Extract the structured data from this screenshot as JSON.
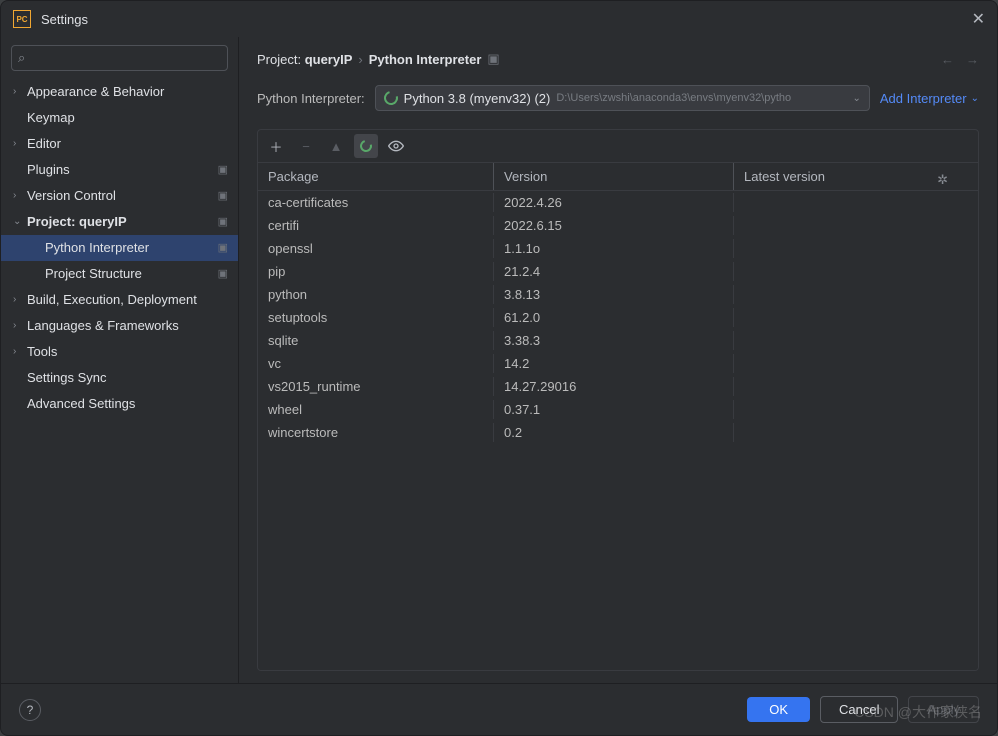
{
  "window": {
    "title": "Settings"
  },
  "search": {
    "placeholder": ""
  },
  "tree": {
    "appearance": "Appearance & Behavior",
    "keymap": "Keymap",
    "editor": "Editor",
    "plugins": "Plugins",
    "vcs": "Version Control",
    "project": "Project: queryIP",
    "python_interpreter": "Python Interpreter",
    "project_structure": "Project Structure",
    "build": "Build, Execution, Deployment",
    "languages": "Languages & Frameworks",
    "tools": "Tools",
    "settings_sync": "Settings Sync",
    "advanced": "Advanced Settings"
  },
  "breadcrumb": {
    "project_prefix": "Project: ",
    "project_name": "queryIP",
    "page": "Python Interpreter"
  },
  "interpreter": {
    "label": "Python Interpreter:",
    "name": "Python 3.8 (myenv32) (2)",
    "path": "D:\\Users\\zwshi\\anaconda3\\envs\\myenv32\\pytho",
    "add_label": "Add Interpreter"
  },
  "packages": {
    "headers": {
      "package": "Package",
      "version": "Version",
      "latest": "Latest version"
    },
    "rows": [
      {
        "name": "ca-certificates",
        "version": "2022.4.26",
        "latest": ""
      },
      {
        "name": "certifi",
        "version": "2022.6.15",
        "latest": ""
      },
      {
        "name": "openssl",
        "version": "1.1.1o",
        "latest": ""
      },
      {
        "name": "pip",
        "version": "21.2.4",
        "latest": ""
      },
      {
        "name": "python",
        "version": "3.8.13",
        "latest": ""
      },
      {
        "name": "setuptools",
        "version": "61.2.0",
        "latest": ""
      },
      {
        "name": "sqlite",
        "version": "3.38.3",
        "latest": ""
      },
      {
        "name": "vc",
        "version": "14.2",
        "latest": ""
      },
      {
        "name": "vs2015_runtime",
        "version": "14.27.29016",
        "latest": ""
      },
      {
        "name": "wheel",
        "version": "0.37.1",
        "latest": ""
      },
      {
        "name": "wincertstore",
        "version": "0.2",
        "latest": ""
      }
    ]
  },
  "footer": {
    "ok": "OK",
    "cancel": "Cancel",
    "apply": "Apply"
  },
  "watermark": "CSDN @大作家侠名"
}
